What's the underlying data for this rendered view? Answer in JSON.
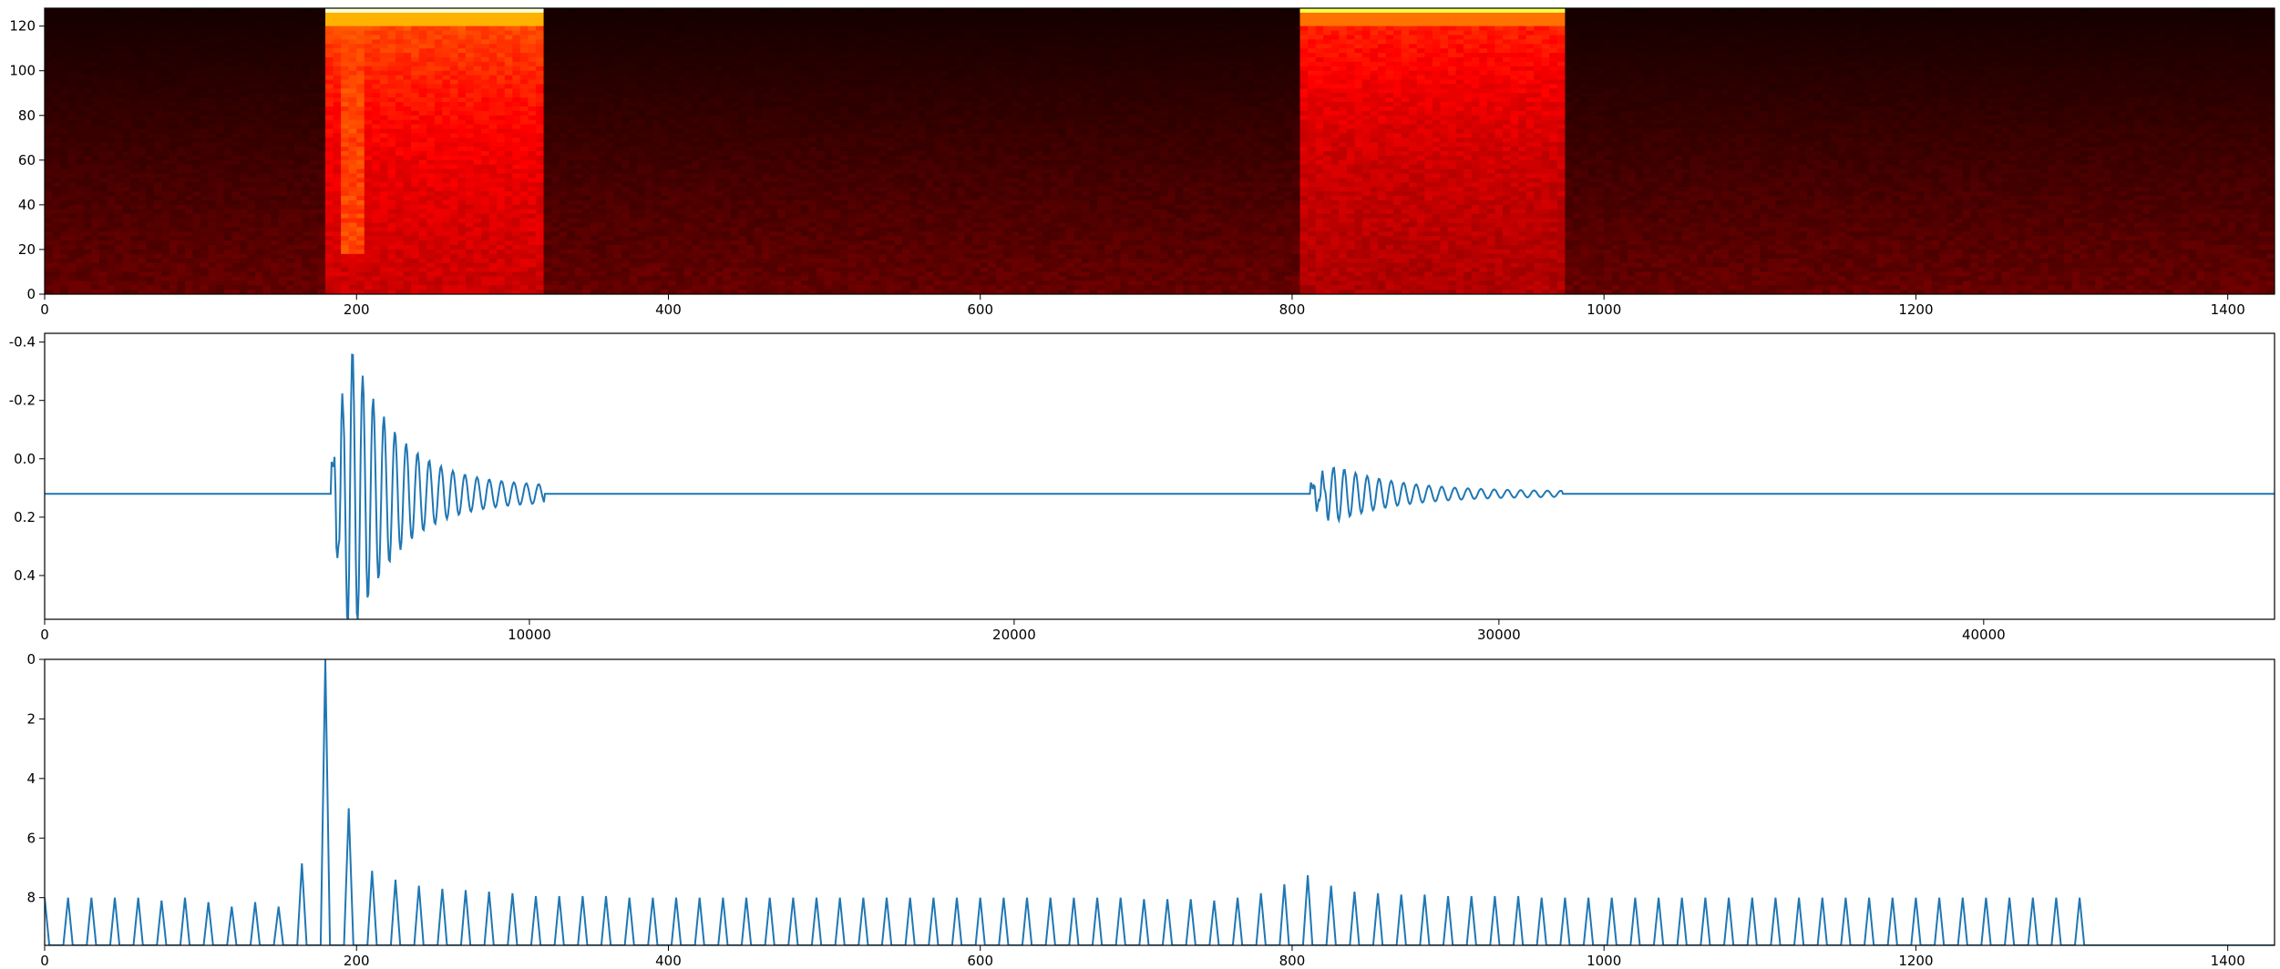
{
  "chart_data": [
    {
      "type": "heatmap",
      "title": "",
      "xlabel": "",
      "ylabel": "",
      "xlim": [
        0,
        1430
      ],
      "ylim": [
        128,
        0
      ],
      "xticks": [
        0,
        200,
        400,
        600,
        800,
        1000,
        1200,
        1400
      ],
      "yticks": [
        0,
        20,
        40,
        60,
        80,
        100,
        120
      ],
      "colormap": "hot",
      "events": [
        {
          "x_start": 178,
          "x_end": 318,
          "peak": 1.0
        },
        {
          "x_start": 806,
          "x_end": 976,
          "peak": 0.85
        }
      ]
    },
    {
      "type": "line",
      "title": "",
      "xlabel": "",
      "ylabel": "",
      "xlim": [
        0,
        46000
      ],
      "ylim": [
        -0.43,
        0.55
      ],
      "xticks": [
        0,
        10000,
        20000,
        30000,
        40000
      ],
      "yticks": [
        -0.4,
        -0.2,
        0.0,
        0.2,
        0.4
      ],
      "color": "#1f77b4",
      "bursts": [
        {
          "start": 5900,
          "end": 10300,
          "peak": 0.55,
          "trough": -0.43
        },
        {
          "start": 26100,
          "end": 31300,
          "peak": 0.1,
          "trough": -0.08
        }
      ]
    },
    {
      "type": "line",
      "title": "",
      "xlabel": "",
      "ylabel": "",
      "xlim": [
        0,
        1430
      ],
      "ylim": [
        0,
        9.6
      ],
      "xticks": [
        0,
        200,
        400,
        600,
        800,
        1000,
        1200,
        1400
      ],
      "yticks": [
        0,
        2,
        4,
        6,
        8
      ],
      "color": "#1f77b4",
      "peaks_x": [
        0,
        15,
        30,
        45,
        60,
        75,
        90,
        105,
        120,
        135,
        150,
        165,
        180,
        195,
        210,
        225,
        240,
        255,
        270,
        285,
        300,
        315,
        330,
        345,
        360,
        375,
        390,
        405,
        420,
        435,
        450,
        465,
        480,
        495,
        510,
        525,
        540,
        555,
        570,
        585,
        600,
        615,
        630,
        645,
        660,
        675,
        690,
        705,
        720,
        735,
        750,
        765,
        780,
        795,
        810,
        825,
        840,
        855,
        870,
        885,
        900,
        915,
        930,
        945,
        960,
        975,
        990,
        1005,
        1020,
        1035,
        1050,
        1065,
        1080,
        1095,
        1110,
        1125,
        1140,
        1155,
        1170,
        1185,
        1200,
        1215,
        1230,
        1245,
        1260,
        1275,
        1290,
        1305
      ],
      "peaks_y": [
        1.6,
        1.6,
        1.6,
        1.6,
        1.6,
        1.5,
        1.6,
        1.45,
        1.3,
        1.45,
        1.3,
        2.75,
        9.6,
        4.6,
        2.5,
        2.2,
        2.0,
        1.9,
        1.85,
        1.8,
        1.75,
        1.65,
        1.65,
        1.65,
        1.65,
        1.6,
        1.6,
        1.6,
        1.6,
        1.6,
        1.6,
        1.6,
        1.6,
        1.6,
        1.6,
        1.6,
        1.6,
        1.6,
        1.6,
        1.6,
        1.6,
        1.6,
        1.6,
        1.6,
        1.6,
        1.6,
        1.6,
        1.55,
        1.55,
        1.55,
        1.5,
        1.6,
        1.75,
        2.05,
        2.35,
        2.0,
        1.8,
        1.75,
        1.7,
        1.7,
        1.65,
        1.65,
        1.65,
        1.65,
        1.6,
        1.6,
        1.6,
        1.6,
        1.6,
        1.6,
        1.6,
        1.6,
        1.6,
        1.6,
        1.6,
        1.6,
        1.6,
        1.6,
        1.6,
        1.6,
        1.6,
        1.6,
        1.6,
        1.6,
        1.6,
        1.6,
        1.6,
        1.6
      ]
    }
  ]
}
